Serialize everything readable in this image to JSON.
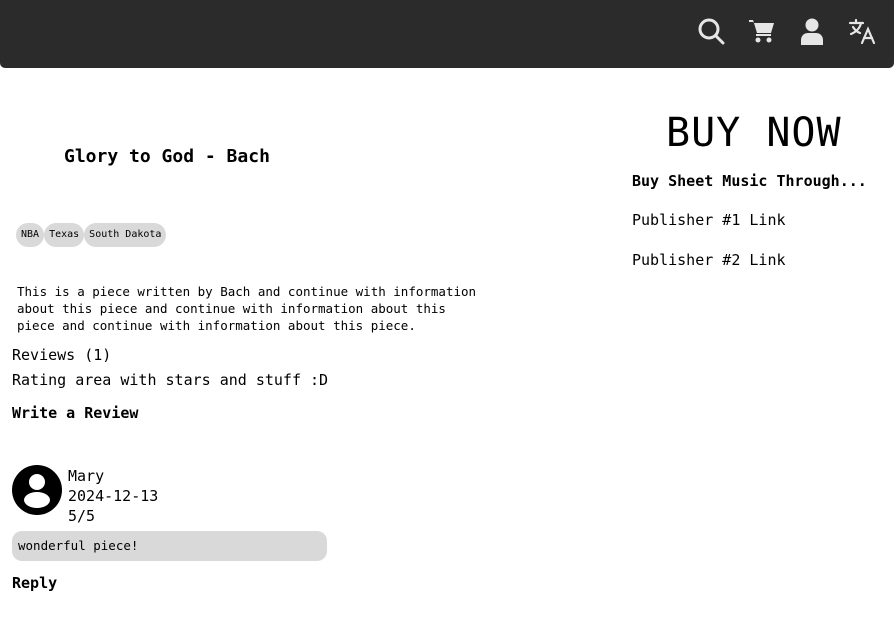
{
  "nav": {
    "icons": [
      "search-icon",
      "cart-icon",
      "user-icon",
      "translate-icon"
    ],
    "bar_color": "#2b2b2b"
  },
  "piece": {
    "title": "Glory to God - Bach",
    "tags": [
      "NBA",
      "Texas",
      "South Dakota"
    ],
    "description": "This is a piece written by Bach and continue with information about this piece and continue with information about this piece and continue with information about this piece."
  },
  "reviews": {
    "heading": "Reviews (1)",
    "rating_area": "Rating area with stars and stuff :D",
    "write_label": "Write a Review",
    "items": [
      {
        "author": "Mary",
        "date": "2024-12-13",
        "score": "5/5",
        "text": "wonderful piece!",
        "reply_label": "Reply"
      }
    ]
  },
  "buy": {
    "heading": "BUY NOW",
    "subheading": "Buy Sheet Music Through...",
    "links": [
      "Publisher #1 Link",
      "Publisher #2 Link"
    ]
  }
}
